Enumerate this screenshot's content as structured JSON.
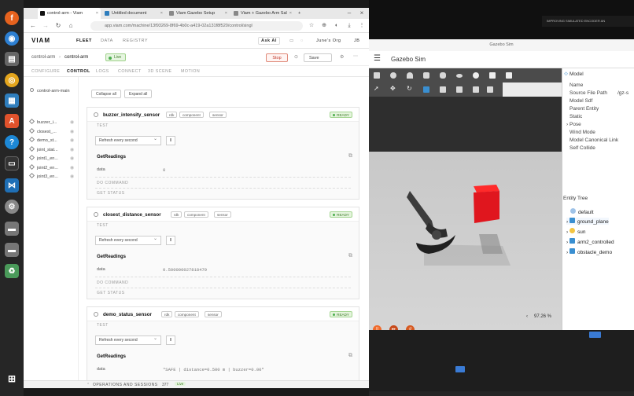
{
  "browser": {
    "tabs": [
      {
        "label": "control-arm - Viam"
      },
      {
        "label": "Untitled document"
      },
      {
        "label": "Viam Gazebo Setup"
      },
      {
        "label": "Viam + Gazebo Arm Sal"
      }
    ],
    "new_tab": "+",
    "url": "app.viam.com/machine/13f93269-8f69-4b0c-a419-02a131f8f520/control/singl"
  },
  "viam": {
    "logo": "VIAM",
    "topnav": [
      "FLEET",
      "DATA",
      "REGISTRY"
    ],
    "ask_ai": "Ask AI",
    "org": "June's Org",
    "avatar": "JB",
    "breadcrumb": [
      "control-arm",
      "control-arm"
    ],
    "live": "Live",
    "stop": "Stop",
    "save": "Save",
    "tabs": [
      "CONFIGURE",
      "CONTROL",
      "LOGS",
      "CONNECT",
      "3D SCENE",
      "MOTION"
    ],
    "left_root": "control-arm-main",
    "left_items": [
      "buzzer_i...",
      "closest_...",
      "demo_st...",
      "joint_stat...",
      "joint1_en...",
      "joint2_en...",
      "joint3_en..."
    ],
    "collapse_all": "Collapse all",
    "expand_all": "Expand all",
    "cards": [
      {
        "name": "buzzer_intensity_sensor",
        "tags": [
          "rdk",
          "component",
          "sensor"
        ],
        "status": "READY",
        "test": "TEST",
        "refresh": "Refresh every second",
        "pause": "II",
        "get_readings": "GetReadings",
        "data_label": "data",
        "data_value": "0",
        "do_command": "DO COMMAND",
        "get_status": "GET STATUS"
      },
      {
        "name": "closest_distance_sensor",
        "tags": [
          "rdk",
          "component",
          "sensor"
        ],
        "status": "READY",
        "test": "TEST",
        "refresh": "Refresh every second",
        "pause": "II",
        "get_readings": "GetReadings",
        "data_label": "data",
        "data_value": "0.500000027818479",
        "do_command": "DO COMMAND",
        "get_status": "GET STATUS"
      },
      {
        "name": "demo_status_sensor",
        "tags": [
          "rdk",
          "component",
          "sensor"
        ],
        "status": "READY",
        "test": "TEST",
        "refresh": "Refresh every second",
        "pause": "II",
        "get_readings": "GetReadings",
        "data_label": "data",
        "data_value": "\"SAFE | distance=0.500 m | buzzer=0.00\""
      }
    ],
    "ops_label": "OPERATIONS AND SESSIONS",
    "ops_count": "377",
    "ops_badge": "Live"
  },
  "gazebo": {
    "window_title": "Gazebo Sim",
    "app_name": "Gazebo Sim",
    "panel_title": "Model",
    "properties": [
      "Name",
      "Source File Path",
      "Model Sdf",
      "Parent Entity",
      "Static",
      "Pose",
      "Wind Mode",
      "Model Canonical Link",
      "Self Collide"
    ],
    "source_path_value": "/gz-s",
    "entity_tree_title": "Entity Tree",
    "entities": [
      "default",
      "ground_plane",
      "sun",
      "arm2_controlled",
      "obstacle_demo"
    ],
    "zoom": "97.26 %"
  },
  "background": {
    "notification": "IMPROVING SIMULATED ENCODER AN"
  },
  "colors": {
    "accent": "#f06a2b",
    "ready_green": "#4caf50",
    "stop_red": "#c0392b",
    "box_red": "#e0161e"
  }
}
